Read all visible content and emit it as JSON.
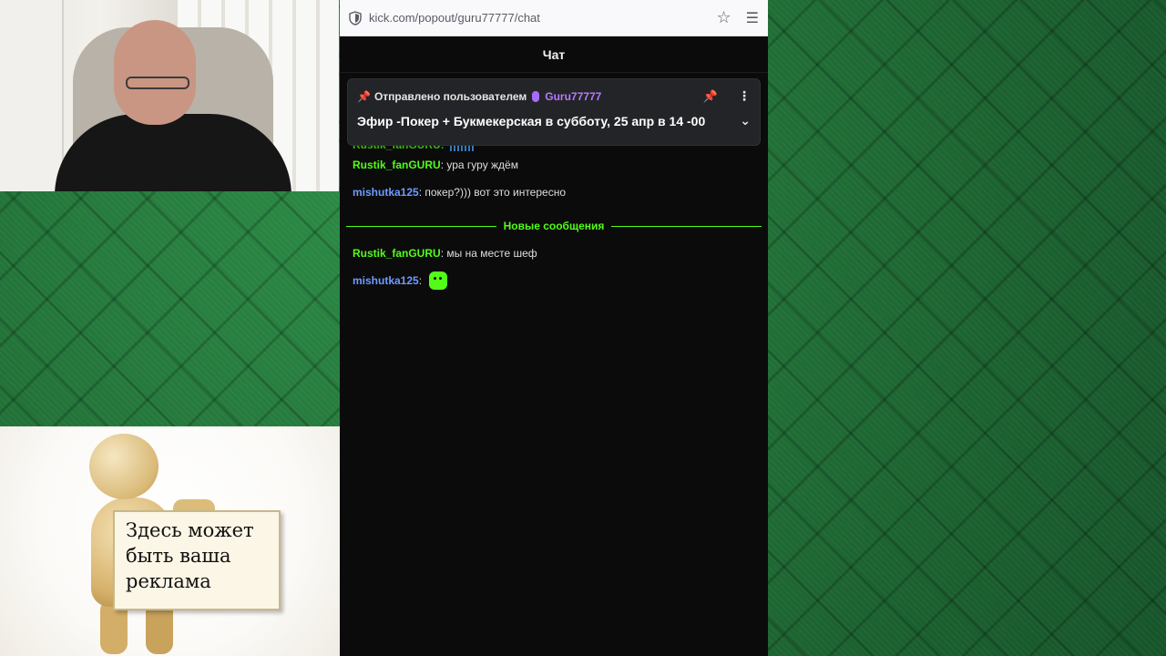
{
  "browser": {
    "url": "kick.com/popout/guru77777/chat"
  },
  "chat": {
    "header_title": "Чат",
    "pinned": {
      "label": "Отправлено пользователем",
      "username": "Guru77777",
      "message": "Эфир -Покер + Букмекерская в субботу, 25 апр в 14 -00"
    },
    "partial_username": "Rustik_fanGURU:",
    "messages_before": [
      {
        "username": "Rustik_fanGURU",
        "separator": ":",
        "text": " ура гуру ждём"
      },
      {
        "username": "mishutka125",
        "separator": ":",
        "text": " покер?))) вот это интересно"
      }
    ],
    "divider_label": "Новые сообщения",
    "messages_after": [
      {
        "username": "Rustik_fanGURU",
        "separator": ":",
        "text": " мы на месте шеф"
      },
      {
        "username": "mishutka125",
        "separator": ":",
        "text": ""
      }
    ],
    "colors": {
      "accent": "#53fc18",
      "username_blue": "#6f9bff",
      "pinned_user": "#b57bff"
    }
  },
  "ad": {
    "line1": "Здесь может",
    "line2": "быть ваша",
    "line3": "реклама"
  },
  "icons": [
    "shield-icon",
    "star-icon",
    "hamburger-menu-icon",
    "pin-icon",
    "kebab-menu-icon",
    "chevron-down-icon",
    "emote-icon"
  ]
}
